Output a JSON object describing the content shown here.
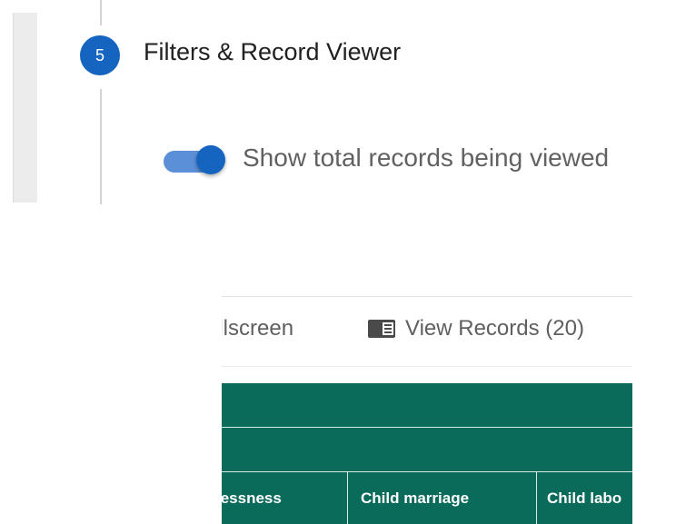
{
  "stepper": {
    "step_number": "5",
    "step_title": "Filters & Record Viewer",
    "toggle": {
      "label": "Show total records being viewed",
      "checked": true,
      "accent_color": "#1565c0"
    }
  },
  "viewer": {
    "toolbar": {
      "fullscreen_label": "ullscreen",
      "view_records_label": "View Records (20)",
      "view_records_icon": "book-icon"
    },
    "table": {
      "header_color": "#0b6b5b",
      "columns": [
        "lessness",
        "Child marriage",
        "Child labo"
      ]
    }
  }
}
